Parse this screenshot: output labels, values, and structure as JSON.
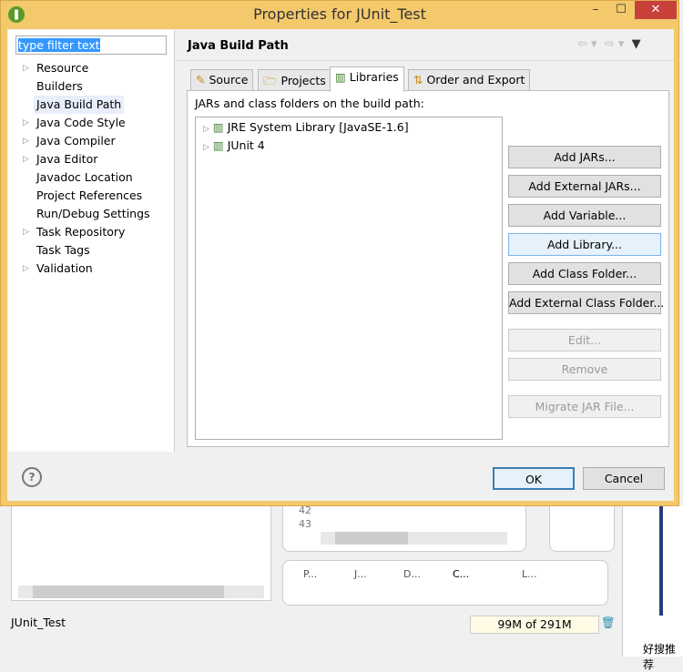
{
  "dialog": {
    "title": "Properties for JUnit_Test",
    "minimize": "–",
    "maximize": "☐",
    "close": "✕"
  },
  "filter": {
    "value": "type filter text"
  },
  "nav": [
    {
      "label": "Resource",
      "expandable": true
    },
    {
      "label": "Builders",
      "expandable": false
    },
    {
      "label": "Java Build Path",
      "expandable": false,
      "selected": true
    },
    {
      "label": "Java Code Style",
      "expandable": true
    },
    {
      "label": "Java Compiler",
      "expandable": true
    },
    {
      "label": "Java Editor",
      "expandable": true
    },
    {
      "label": "Javadoc Location",
      "expandable": false
    },
    {
      "label": "Project References",
      "expandable": false
    },
    {
      "label": "Run/Debug Settings",
      "expandable": false
    },
    {
      "label": "Task Repository",
      "expandable": true
    },
    {
      "label": "Task Tags",
      "expandable": false
    },
    {
      "label": "Validation",
      "expandable": true
    }
  ],
  "page": {
    "title": "Java Build Path",
    "path_label": "JARs and class folders on the build path:"
  },
  "tabs": [
    "Source",
    "Projects",
    "Libraries",
    "Order and Export"
  ],
  "libraries": [
    "JRE System Library [JavaSE-1.6]",
    "JUnit 4"
  ],
  "buttons": [
    "Add JARs...",
    "Add External JARs...",
    "Add Variable...",
    "Add Library...",
    "Add Class Folder...",
    "Add External Class Folder...",
    "Edit...",
    "Remove",
    "Migrate JAR File..."
  ],
  "footer": {
    "ok": "OK",
    "cancel": "Cancel",
    "help": "?"
  },
  "background": {
    "line42": "42",
    "line43": "43",
    "views": [
      "P...",
      "J...",
      "D...",
      "C...",
      "L..."
    ],
    "status": "JUnit_Test",
    "heap": "99M of 291M",
    "chinese": "好搜推荐"
  }
}
